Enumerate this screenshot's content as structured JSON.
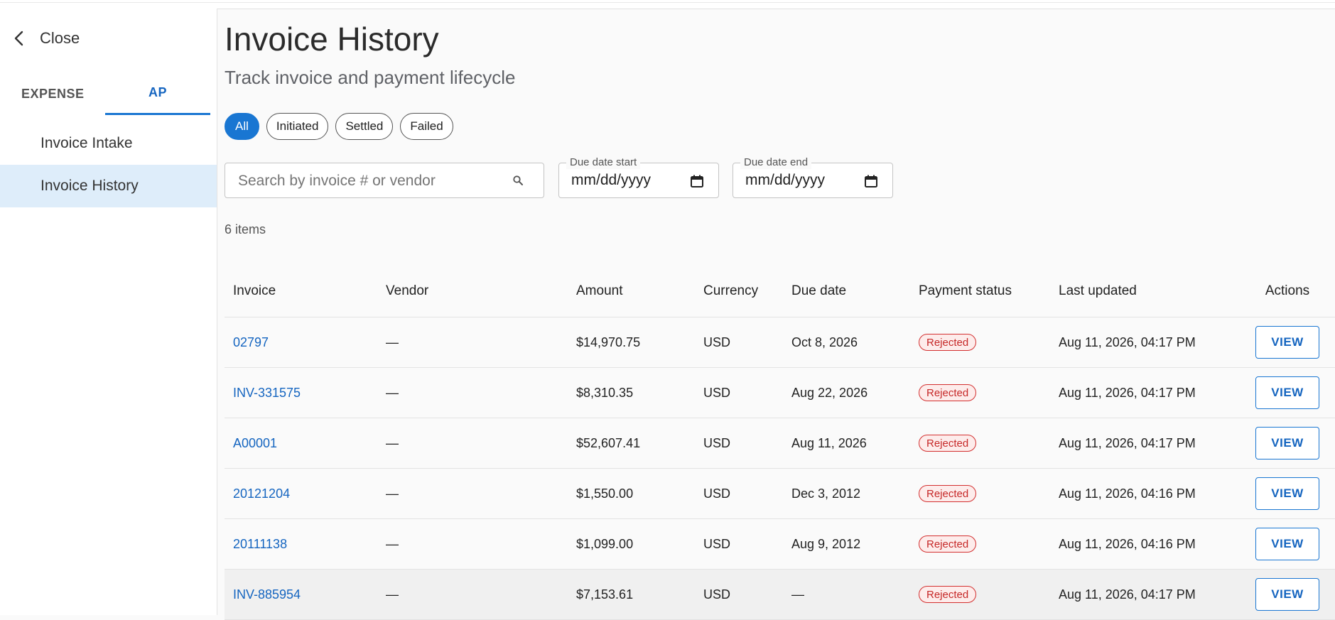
{
  "sidebar": {
    "close_label": "Close",
    "tabs": [
      {
        "label": "EXPENSE",
        "active": false
      },
      {
        "label": "AP",
        "active": true
      }
    ],
    "items": [
      {
        "label": "Invoice Intake",
        "selected": false
      },
      {
        "label": "Invoice History",
        "selected": true
      }
    ]
  },
  "header": {
    "title": "Invoice History",
    "subtitle": "Track invoice and payment lifecycle"
  },
  "filters": {
    "chips": [
      {
        "label": "All",
        "active": true
      },
      {
        "label": "Initiated",
        "active": false
      },
      {
        "label": "Settled",
        "active": false
      },
      {
        "label": "Failed",
        "active": false
      }
    ],
    "search_placeholder": "Search by invoice # or vendor",
    "due_start_label": "Due date start",
    "due_start_value": "mm/dd/yyyy",
    "due_end_label": "Due date end",
    "due_end_value": "mm/dd/yyyy"
  },
  "item_count": "6 items",
  "table": {
    "columns": [
      "Invoice",
      "Vendor",
      "Amount",
      "Currency",
      "Due date",
      "Payment status",
      "Last updated",
      "Actions"
    ],
    "rows": [
      {
        "invoice": "02797",
        "vendor": "—",
        "amount": "$14,970.75",
        "currency": "USD",
        "due": "Oct 8, 2026",
        "status": "Rejected",
        "updated": "Aug 11, 2026, 04:17 PM",
        "action": "VIEW"
      },
      {
        "invoice": "INV-331575",
        "vendor": "—",
        "amount": "$8,310.35",
        "currency": "USD",
        "due": "Aug 22, 2026",
        "status": "Rejected",
        "updated": "Aug 11, 2026, 04:17 PM",
        "action": "VIEW"
      },
      {
        "invoice": "A00001",
        "vendor": "—",
        "amount": "$52,607.41",
        "currency": "USD",
        "due": "Aug 11, 2026",
        "status": "Rejected",
        "updated": "Aug 11, 2026, 04:17 PM",
        "action": "VIEW"
      },
      {
        "invoice": "20121204",
        "vendor": "—",
        "amount": "$1,550.00",
        "currency": "USD",
        "due": "Dec 3, 2012",
        "status": "Rejected",
        "updated": "Aug 11, 2026, 04:16 PM",
        "action": "VIEW"
      },
      {
        "invoice": "20111138",
        "vendor": "—",
        "amount": "$1,099.00",
        "currency": "USD",
        "due": "Aug 9, 2012",
        "status": "Rejected",
        "updated": "Aug 11, 2026, 04:16 PM",
        "action": "VIEW"
      },
      {
        "invoice": "INV-885954",
        "vendor": "—",
        "amount": "$7,153.61",
        "currency": "USD",
        "due": "—",
        "status": "Rejected",
        "updated": "Aug 11, 2026, 04:17 PM",
        "action": "VIEW"
      }
    ]
  },
  "colors": {
    "accent": "#1976d2",
    "selected_nav_bg": "#deedfa",
    "rejected": "#d32f2f"
  },
  "icons": {
    "close": "chevron-left-icon",
    "search": "search-icon",
    "calendar": "calendar-icon"
  }
}
